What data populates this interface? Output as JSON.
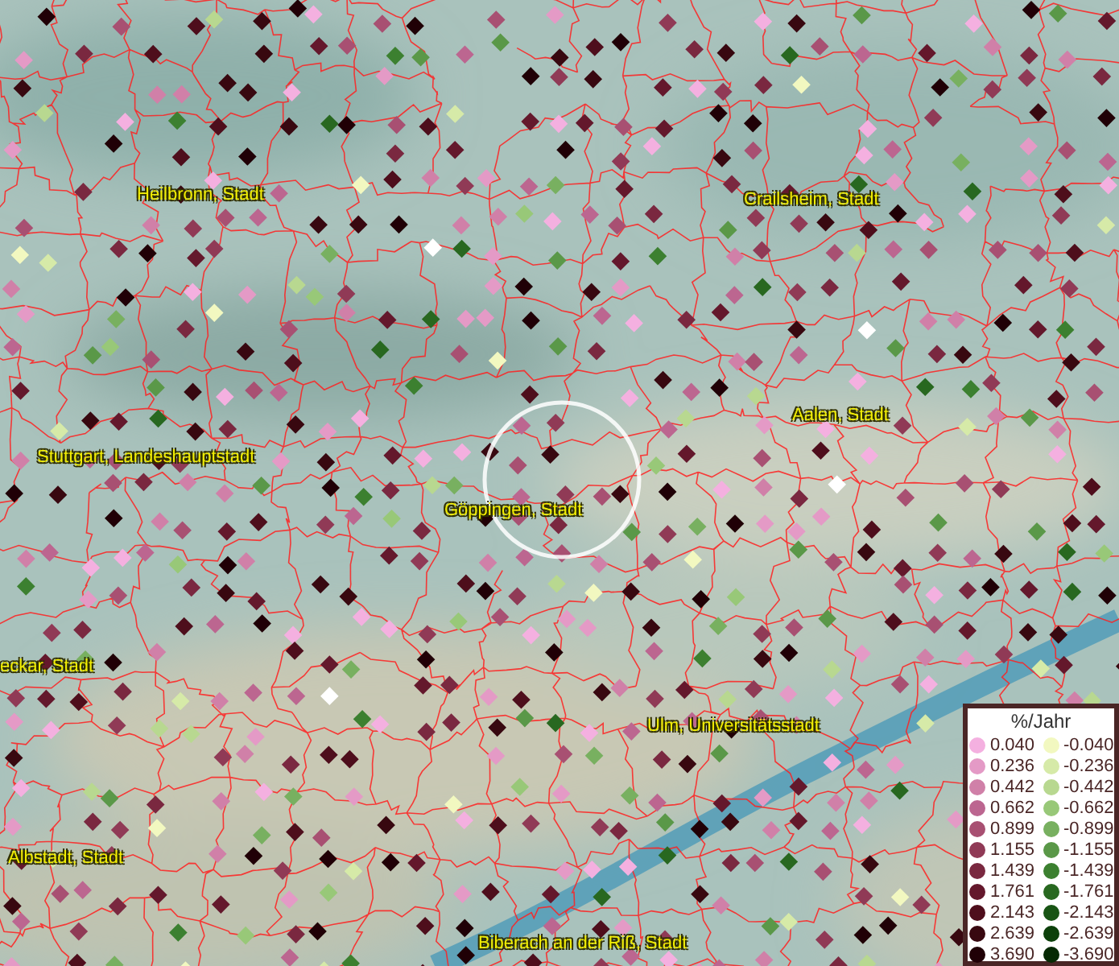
{
  "map": {
    "labels": [
      {
        "text": "Heilbronn, Stadt"
      },
      {
        "text": "Crailsheim, Stadt"
      },
      {
        "text": "Stuttgart, Landeshauptstadt"
      },
      {
        "text": "Aalen, Stadt"
      },
      {
        "text": "Göppingen, Stadt"
      },
      {
        "text": "eckar, Stadt"
      },
      {
        "text": "Ulm, Universitätsstadt"
      },
      {
        "text": "Albstadt, Stadt"
      },
      {
        "text": "Biberach an der Riß, Stadt"
      }
    ]
  },
  "legend": {
    "title": "%/Jahr",
    "left": [
      {
        "value": "0.040",
        "color": "#f4b0e0"
      },
      {
        "value": "0.236",
        "color": "#e49ac6"
      },
      {
        "value": "0.442",
        "color": "#d080a8"
      },
      {
        "value": "0.662",
        "color": "#bc6690"
      },
      {
        "value": "0.899",
        "color": "#a85072"
      },
      {
        "value": "1.155",
        "color": "#903a56"
      },
      {
        "value": "1.439",
        "color": "#7a2840"
      },
      {
        "value": "1.761",
        "color": "#64182c"
      },
      {
        "value": "2.143",
        "color": "#4e0e1c"
      },
      {
        "value": "2.639",
        "color": "#380810"
      },
      {
        "value": "3.690",
        "color": "#200006"
      }
    ],
    "right": [
      {
        "value": "-0.040",
        "color": "#f2f8c0"
      },
      {
        "value": "-0.236",
        "color": "#d6eaa8"
      },
      {
        "value": "-0.442",
        "color": "#b8d890"
      },
      {
        "value": "-0.662",
        "color": "#98c878"
      },
      {
        "value": "-0.899",
        "color": "#78b060"
      },
      {
        "value": "-1.155",
        "color": "#5a9848"
      },
      {
        "value": "-1.439",
        "color": "#3c8030"
      },
      {
        "value": "-1.761",
        "color": "#286820"
      },
      {
        "value": "-2.143",
        "color": "#185414"
      },
      {
        "value": "-2.639",
        "color": "#0c400a"
      },
      {
        "value": "-3.690",
        "color": "#062a04"
      }
    ]
  }
}
